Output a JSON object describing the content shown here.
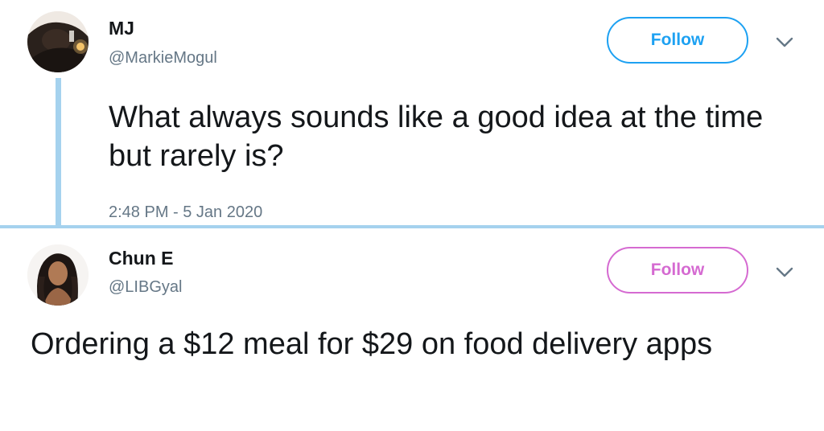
{
  "tweet1": {
    "display_name": "MJ",
    "handle": "@MarkieMogul",
    "follow_label": "Follow",
    "text": "What always sounds like a good idea at the time but rarely is?",
    "timestamp": "2:48 PM - 5 Jan 2020",
    "follow_color": "#1da1f2",
    "avatar_icon": "person-photo",
    "menu_icon": "chevron-down-icon"
  },
  "tweet2": {
    "display_name": "Chun E",
    "handle": "@LIBGyal",
    "follow_label": "Follow",
    "text": "Ordering a $12 meal for $29 on food delivery apps",
    "follow_color": "#d56ad1",
    "avatar_icon": "person-photo",
    "menu_icon": "chevron-down-icon"
  },
  "colors": {
    "thread_line": "#a5d2ee",
    "text": "#14171a",
    "secondary_text": "#657786"
  }
}
